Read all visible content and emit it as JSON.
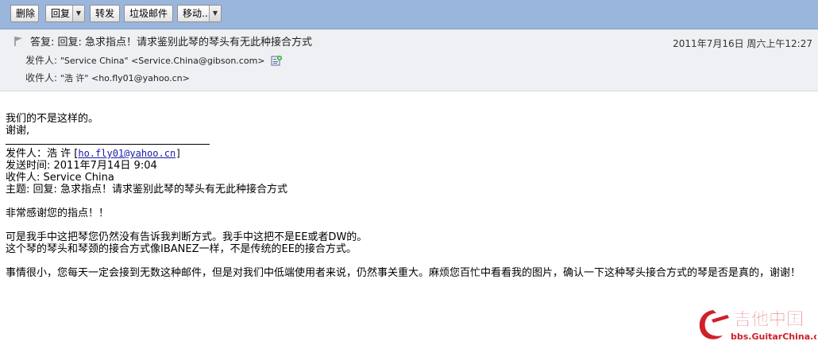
{
  "toolbar": {
    "delete": "删除",
    "reply": "回复",
    "forward": "转发",
    "spam": "垃圾邮件",
    "move": "移动..."
  },
  "header": {
    "subject": "答复: 回复: 急求指点！请求鉴别此琴的琴头有无此种接合方式",
    "date": "2011年7月16日  周六上午12:27",
    "from_label": "发件人:",
    "from_value": "\"Service China\" <Service.China@gibson.com>",
    "to_label": "收件人:",
    "to_value": "\"浩 许\" <ho.fly01@yahoo.cn>"
  },
  "body": {
    "line1": "我们的不是这样的。",
    "line2": "谢谢,",
    "quote_from_label": "发件人：浩 许 [",
    "quote_from_email": "ho.fly01@yahoo.cn",
    "quote_from_end": "]",
    "quote_sent": "发送时间: 2011年7月14日 9:04",
    "quote_to": "收件人: Service China",
    "quote_subject": "主题: 回复: 急求指点！请求鉴别此琴的琴头有无此种接合方式",
    "p1": "非常感谢您的指点！！",
    "p2a": "可是我手中这把琴您仍然没有告诉我判断方式。我手中这把不是EE或者DW的。",
    "p2b": "这个琴的琴头和琴颈的接合方式像IBANEZ一样，不是传统的EE的接合方式。",
    "p3": "事情很小，您每天一定会接到无数这种邮件，但是对我们中低端使用者来说，仍然事关重大。麻烦您百忙中看看我的图片，确认一下这种琴头接合方式的琴是否是真的，谢谢！"
  },
  "watermark": {
    "brand": "吉他中国",
    "url": "bbs.GuitarChina.com"
  },
  "colors": {
    "toolbar_bg": "#9bb6dc",
    "header_bg": "#eef0f3",
    "watermark_red": "#d0202a"
  }
}
